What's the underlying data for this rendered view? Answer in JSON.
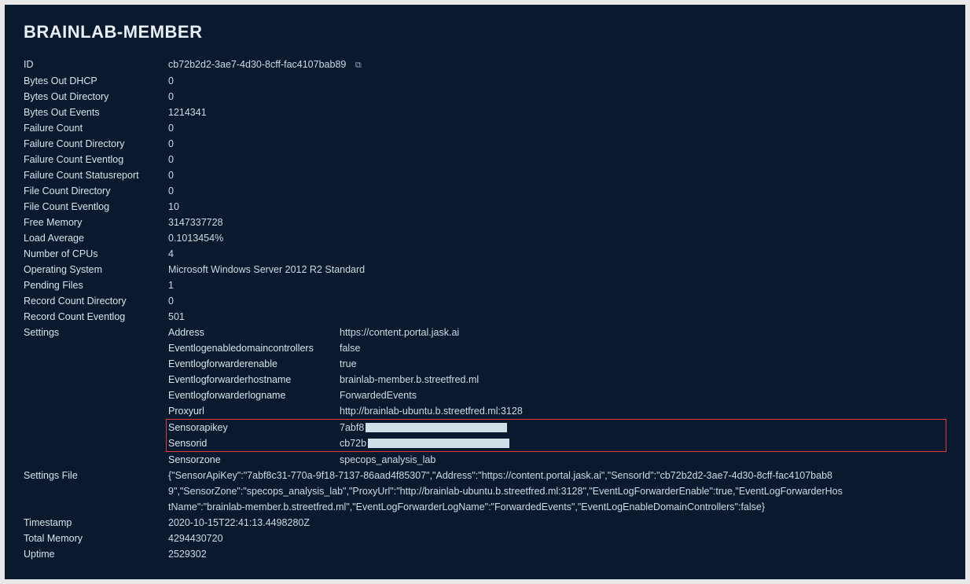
{
  "title": "BRAINLAB-MEMBER",
  "fields": {
    "id": {
      "label": "ID",
      "value": "cb72b2d2-3ae7-4d30-8cff-fac4107bab89"
    },
    "bytesOutDhcp": {
      "label": "Bytes Out DHCP",
      "value": "0"
    },
    "bytesOutDirectory": {
      "label": "Bytes Out Directory",
      "value": "0"
    },
    "bytesOutEvents": {
      "label": "Bytes Out Events",
      "value": "1214341"
    },
    "failureCount": {
      "label": "Failure Count",
      "value": "0"
    },
    "failureCountDirectory": {
      "label": "Failure Count Directory",
      "value": "0"
    },
    "failureCountEventlog": {
      "label": "Failure Count Eventlog",
      "value": "0"
    },
    "failureCountStatusreport": {
      "label": "Failure Count Statusreport",
      "value": "0"
    },
    "fileCountDirectory": {
      "label": "File Count Directory",
      "value": "0"
    },
    "fileCountEventlog": {
      "label": "File Count Eventlog",
      "value": "10"
    },
    "freeMemory": {
      "label": "Free Memory",
      "value": "3147337728"
    },
    "loadAverage": {
      "label": "Load Average",
      "value": "0.1013454%"
    },
    "numberOfCpus": {
      "label": "Number of CPUs",
      "value": "4"
    },
    "operatingSystem": {
      "label": "Operating System",
      "value": "Microsoft Windows Server 2012 R2 Standard"
    },
    "pendingFiles": {
      "label": "Pending Files",
      "value": "1"
    },
    "recordCountDirectory": {
      "label": "Record Count Directory",
      "value": "0"
    },
    "recordCountEventlog": {
      "label": "Record Count Eventlog",
      "value": "501"
    }
  },
  "settingsLabel": "Settings",
  "settings": {
    "address": {
      "label": "Address",
      "value": "https://content.portal.jask.ai"
    },
    "eventlogenabledomaincontrollers": {
      "label": "Eventlogenabledomaincontrollers",
      "value": "false"
    },
    "eventlogforwarderenable": {
      "label": "Eventlogforwarderenable",
      "value": "true"
    },
    "eventlogforwarderhostname": {
      "label": "Eventlogforwarderhostname",
      "value": "brainlab-member.b.streetfred.ml"
    },
    "eventlogforwarderlogname": {
      "label": "Eventlogforwarderlogname",
      "value": "ForwardedEvents"
    },
    "proxyurl": {
      "label": "Proxyurl",
      "value": "http://brainlab-ubuntu.b.streetfred.ml:3128"
    },
    "sensorapikey": {
      "label": "Sensorapikey",
      "prefix": "7abf8"
    },
    "sensorid": {
      "label": "Sensorid",
      "prefix": "cb72b"
    },
    "sensorzone": {
      "label": "Sensorzone",
      "value": "specops_analysis_lab"
    }
  },
  "settingsFile": {
    "label": "Settings File",
    "value": "{\"SensorApiKey\":\"7abf8c31-770a-9f18-7137-86aad4f85307\",\"Address\":\"https://content.portal.jask.ai\",\"SensorId\":\"cb72b2d2-3ae7-4d30-8cff-fac4107bab89\",\"SensorZone\":\"specops_analysis_lab\",\"ProxyUrl\":\"http://brainlab-ubuntu.b.streetfred.ml:3128\",\"EventLogForwarderEnable\":true,\"EventLogForwarderHostName\":\"brainlab-member.b.streetfred.ml\",\"EventLogForwarderLogName\":\"ForwardedEvents\",\"EventLogEnableDomainControllers\":false}"
  },
  "timestamp": {
    "label": "Timestamp",
    "value": "2020-10-15T22:41:13.4498280Z"
  },
  "totalMemory": {
    "label": "Total Memory",
    "value": "4294430720"
  },
  "uptime": {
    "label": "Uptime",
    "value": "2529302"
  }
}
